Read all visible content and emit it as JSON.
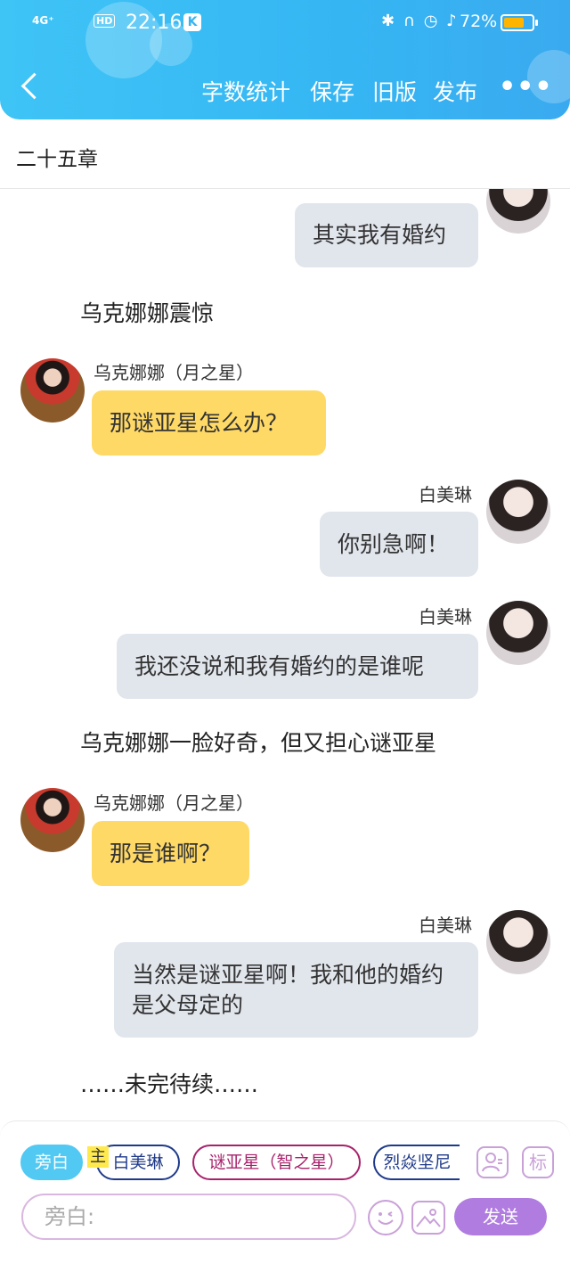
{
  "status_bar": {
    "signal": "4G⁺",
    "hd": "HD",
    "time": "22:16",
    "k_badge": "K",
    "icons": "✱ ∩ ◷ ♪",
    "battery_pct": "72%",
    "battery_level": 0.72
  },
  "toolbar": {
    "word_count": "字数统计",
    "save": "保存",
    "old_version": "旧版",
    "publish": "发布",
    "more": "•••"
  },
  "chapter": {
    "title": "二十五章"
  },
  "messages": {
    "m0_text": "其实我有婚约",
    "n1": "乌克娜娜震惊",
    "m2_name": "乌克娜娜（月之星）",
    "m2_text": "那谜亚星怎么办？",
    "m3_name": "白美琳",
    "m3_text": "你别急啊！",
    "m4_name": "白美琳",
    "m4_text": "我还没说和我有婚约的是谁呢",
    "n5": "乌克娜娜一脸好奇，但又担心谜亚星",
    "m6_name": "乌克娜娜（月之星）",
    "m6_text": "那是谁啊？",
    "m7_name": "白美琳",
    "m7_text": "当然是谜亚星啊！我和他的婚约是父母定的",
    "n8": "……未完待续……"
  },
  "composer": {
    "chips": [
      "旁白",
      "白美琳",
      "谜亚星（智之星）",
      "烈焱坚尼"
    ],
    "main_tag": "主",
    "role_icon_text": "标",
    "input_placeholder": "旁白:",
    "send": "发送"
  },
  "colors": {
    "header": "#3ab9f4",
    "gray_bubble": "#e1e5ec",
    "yellow_bubble": "#ffd966",
    "send": "#b07ce0",
    "active_chip": "#52c9f2"
  }
}
